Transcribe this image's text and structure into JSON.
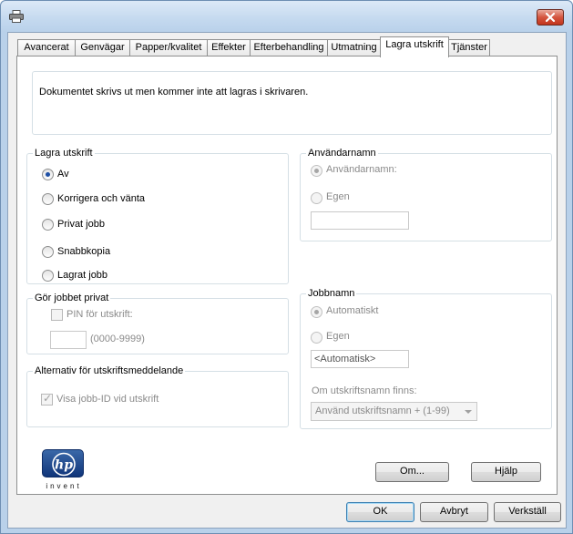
{
  "window": {
    "icon": "printer-icon",
    "close_icon": "close-icon",
    "close_color": "#c2351d"
  },
  "tabs": [
    {
      "label": "Avancerat"
    },
    {
      "label": "Genvägar"
    },
    {
      "label": "Papper/kvalitet"
    },
    {
      "label": "Effekter"
    },
    {
      "label": "Efterbehandling"
    },
    {
      "label": "Utmatning"
    },
    {
      "label": "Lagra utskrift",
      "active": true
    },
    {
      "label": "Tjänster"
    }
  ],
  "message": "Dokumentet skrivs ut men kommer inte att lagras i skrivaren.",
  "store_job": {
    "legend": "Lagra utskrift",
    "options": [
      {
        "label": "Av",
        "checked": true
      },
      {
        "label": "Korrigera och vänta",
        "checked": false
      },
      {
        "label": "Privat jobb",
        "checked": false
      },
      {
        "label": "Snabbkopia",
        "checked": false
      },
      {
        "label": "Lagrat jobb",
        "checked": false
      }
    ]
  },
  "user_name": {
    "legend": "Användarnamn",
    "options": [
      {
        "label": "Användarnamn:",
        "checked": true
      },
      {
        "label": "Egen",
        "checked": false
      }
    ],
    "custom_value": ""
  },
  "private": {
    "legend": "Gör jobbet privat",
    "pin_label": "PIN för utskrift:",
    "pin_value": "",
    "pin_hint": "(0000-9999)"
  },
  "job_name": {
    "legend": "Jobbnamn",
    "options": [
      {
        "label": "Automatiskt",
        "checked": true
      },
      {
        "label": "Egen",
        "checked": false
      }
    ],
    "custom_value": "<Automatisk>",
    "exists_label": "Om utskriftsnamn finns:",
    "exists_value": "Använd utskriftsnamn + (1-99)"
  },
  "notify": {
    "legend": "Alternativ för utskriftsmeddelande",
    "check_label": "Visa jobb-ID vid utskrift",
    "checked": true
  },
  "logo": {
    "mark": "hp",
    "text": "invent",
    "color": "#10357a"
  },
  "buttons": {
    "about": "Om...",
    "help": "Hjälp",
    "ok": "OK",
    "cancel": "Avbryt",
    "apply": "Verkställ"
  }
}
